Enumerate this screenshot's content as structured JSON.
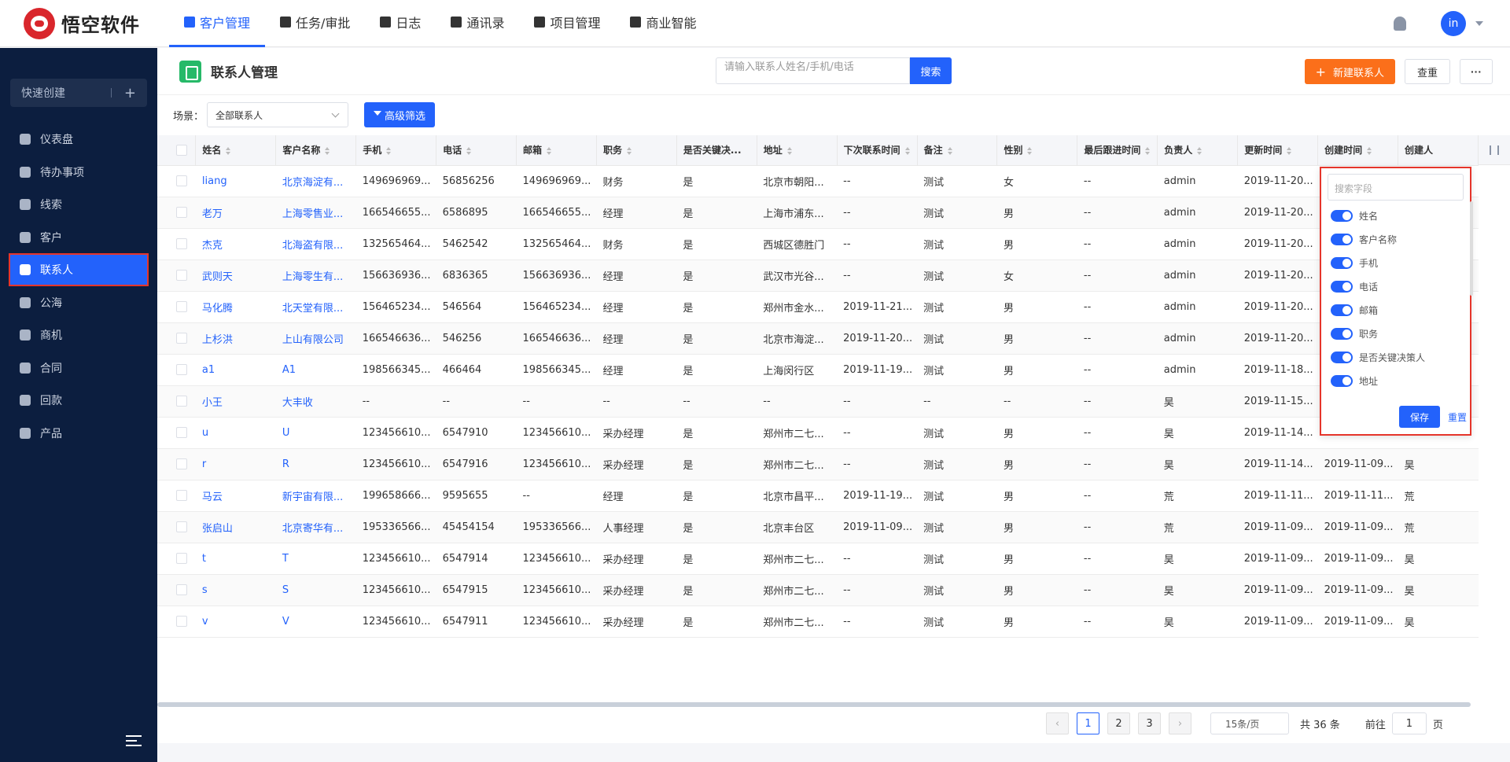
{
  "brand": {
    "name": "悟空软件"
  },
  "nav": [
    {
      "label": "客户管理",
      "icon": "customer-icon",
      "active": true
    },
    {
      "label": "任务/审批",
      "icon": "briefcase-icon",
      "active": false
    },
    {
      "label": "日志",
      "icon": "log-icon",
      "active": false
    },
    {
      "label": "通讯录",
      "icon": "contacts-book-icon",
      "active": false
    },
    {
      "label": "项目管理",
      "icon": "project-icon",
      "active": false
    },
    {
      "label": "商业智能",
      "icon": "bi-icon",
      "active": false
    }
  ],
  "user": {
    "avatar_text": "in"
  },
  "sidebar": {
    "quick_create": "快速创建",
    "items": [
      {
        "label": "仪表盘",
        "icon": "dashboard-icon"
      },
      {
        "label": "待办事项",
        "icon": "todo-icon"
      },
      {
        "label": "线索",
        "icon": "clue-icon"
      },
      {
        "label": "客户",
        "icon": "customer-building-icon"
      },
      {
        "label": "联系人",
        "icon": "contact-card-icon",
        "active": true
      },
      {
        "label": "公海",
        "icon": "pool-icon"
      },
      {
        "label": "商机",
        "icon": "opportunity-icon"
      },
      {
        "label": "合同",
        "icon": "contract-icon"
      },
      {
        "label": "回款",
        "icon": "payment-icon"
      },
      {
        "label": "产品",
        "icon": "product-icon"
      }
    ]
  },
  "header": {
    "title": "联系人管理",
    "search_placeholder": "请输入联系人姓名/手机/电话",
    "search_button": "搜索",
    "new_button": "新建联系人",
    "check_button": "查重",
    "more_button": "···"
  },
  "filter": {
    "scene_label": "场景：",
    "scene_value": "全部联系人",
    "advanced_button": "高级筛选"
  },
  "table": {
    "columns": [
      "姓名",
      "客户名称",
      "手机",
      "电话",
      "邮箱",
      "职务",
      "是否关键决...",
      "地址",
      "下次联系时间",
      "备注",
      "性别",
      "最后跟进时间",
      "负责人",
      "更新时间",
      "创建时间",
      "创建人"
    ],
    "rows": [
      [
        "liang",
        "北京海淀有...",
        "149696969...",
        "56856256",
        "149696969...",
        "财务",
        "是",
        "北京市朝阳...",
        "--",
        "测试",
        "女",
        "--",
        "admin",
        "2019-11-20...",
        "",
        ""
      ],
      [
        "老万",
        "上海零售业...",
        "166546655...",
        "6586895",
        "166546655...",
        "经理",
        "是",
        "上海市浦东...",
        "--",
        "测试",
        "男",
        "--",
        "admin",
        "2019-11-20...",
        "",
        ""
      ],
      [
        "杰克",
        "北海盗有限...",
        "132565464...",
        "5462542",
        "132565464...",
        "财务",
        "是",
        "西城区德胜门",
        "--",
        "测试",
        "男",
        "--",
        "admin",
        "2019-11-20...",
        "",
        ""
      ],
      [
        "武则天",
        "上海零生有...",
        "156636936...",
        "6836365",
        "156636936...",
        "经理",
        "是",
        "武汉市光谷...",
        "--",
        "测试",
        "女",
        "--",
        "admin",
        "2019-11-20...",
        "",
        ""
      ],
      [
        "马化腾",
        "北天堂有限...",
        "156465234...",
        "546564",
        "156465234...",
        "经理",
        "是",
        "郑州市金水...",
        "2019-11-21...",
        "测试",
        "男",
        "--",
        "admin",
        "2019-11-20...",
        "",
        ""
      ],
      [
        "上杉洪",
        "上山有限公司",
        "166546636...",
        "546256",
        "166546636...",
        "经理",
        "是",
        "北京市海淀...",
        "2019-11-20...",
        "测试",
        "男",
        "--",
        "admin",
        "2019-11-20...",
        "",
        ""
      ],
      [
        "a1",
        "A1",
        "198566345...",
        "466464",
        "198566345...",
        "经理",
        "是",
        "上海闵行区",
        "2019-11-19...",
        "测试",
        "男",
        "--",
        "admin",
        "2019-11-18...",
        "",
        ""
      ],
      [
        "小王",
        "大丰收",
        "--",
        "--",
        "--",
        "--",
        "--",
        "--",
        "--",
        "--",
        "--",
        "--",
        "昊",
        "2019-11-15...",
        "",
        ""
      ],
      [
        "u",
        "U",
        "123456610...",
        "6547910",
        "123456610...",
        "采办经理",
        "是",
        "郑州市二七...",
        "--",
        "测试",
        "男",
        "--",
        "昊",
        "2019-11-14...",
        "",
        ""
      ],
      [
        "r",
        "R",
        "123456610...",
        "6547916",
        "123456610...",
        "采办经理",
        "是",
        "郑州市二七...",
        "--",
        "测试",
        "男",
        "--",
        "昊",
        "2019-11-14...",
        "2019-11-09...",
        "昊"
      ],
      [
        "马云",
        "新宇宙有限...",
        "199658666...",
        "9595655",
        "--",
        "经理",
        "是",
        "北京市昌平...",
        "2019-11-19...",
        "测试",
        "男",
        "--",
        "荒",
        "2019-11-11...",
        "2019-11-11...",
        "荒"
      ],
      [
        "张启山",
        "北京寄华有...",
        "195336566...",
        "45454154",
        "195336566...",
        "人事经理",
        "是",
        "北京丰台区",
        "2019-11-09...",
        "测试",
        "男",
        "--",
        "荒",
        "2019-11-09...",
        "2019-11-09...",
        "荒"
      ],
      [
        "t",
        "T",
        "123456610...",
        "6547914",
        "123456610...",
        "采办经理",
        "是",
        "郑州市二七...",
        "--",
        "测试",
        "男",
        "--",
        "昊",
        "2019-11-09...",
        "2019-11-09...",
        "昊"
      ],
      [
        "s",
        "S",
        "123456610...",
        "6547915",
        "123456610...",
        "采办经理",
        "是",
        "郑州市二七...",
        "--",
        "测试",
        "男",
        "--",
        "昊",
        "2019-11-09...",
        "2019-11-09...",
        "昊"
      ],
      [
        "v",
        "V",
        "123456610...",
        "6547911",
        "123456610...",
        "采办经理",
        "是",
        "郑州市二七...",
        "--",
        "测试",
        "男",
        "--",
        "昊",
        "2019-11-09...",
        "2019-11-09...",
        "昊"
      ]
    ]
  },
  "pagination": {
    "pages": [
      "1",
      "2",
      "3"
    ],
    "current": "1",
    "page_size": "15条/页",
    "total": "共 36 条",
    "goto_label": "前往",
    "goto_value": "1",
    "goto_suffix": "页"
  },
  "field_panel": {
    "search_placeholder": "搜索字段",
    "fields": [
      "姓名",
      "客户名称",
      "手机",
      "电话",
      "邮箱",
      "职务",
      "是否关键决策人",
      "地址"
    ],
    "save_button": "保存",
    "reset_button": "重置"
  },
  "colors": {
    "primary": "#2362fb",
    "accent_orange": "#fb6f1a",
    "sidebar_bg": "#0c1e3f",
    "highlight_red": "#e5352b"
  }
}
